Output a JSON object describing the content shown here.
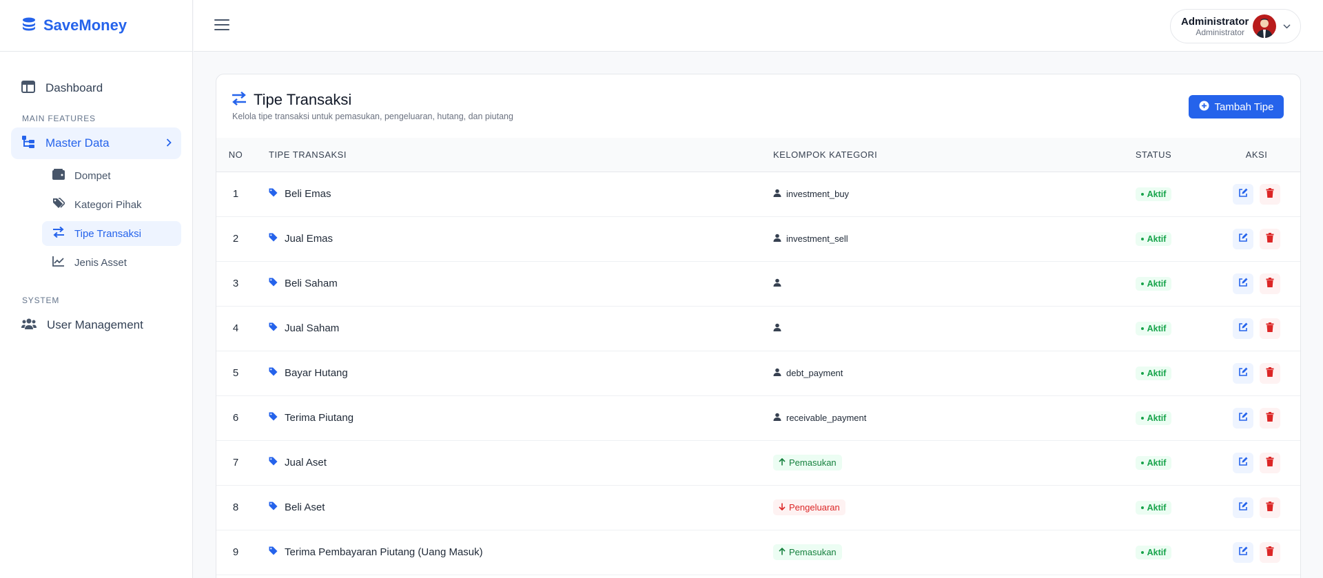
{
  "brand": {
    "name": "SaveMoney"
  },
  "sidebar": {
    "dashboard": "Dashboard",
    "section_main": "MAIN FEATURES",
    "master_data": "Master Data",
    "sub_items": [
      "Dompet",
      "Kategori Pihak",
      "Tipe Transaksi",
      "Jenis Asset"
    ],
    "section_system": "SYSTEM",
    "user_management": "User Management"
  },
  "user": {
    "name": "Administrator",
    "role": "Administrator"
  },
  "page": {
    "title": "Tipe Transaksi",
    "subtitle": "Kelola tipe transaksi untuk pemasukan, pengeluaran, hutang, dan piutang",
    "add_button": "Tambah Tipe"
  },
  "table": {
    "headers": [
      "NO",
      "TIPE TRANSAKSI",
      "KELOMPOK KATEGORI",
      "STATUS",
      "AKSI"
    ],
    "rows": [
      {
        "no": "1",
        "tipe": "Beli Emas",
        "kelompok": "investment_buy",
        "kind": "user",
        "status": "Aktif"
      },
      {
        "no": "2",
        "tipe": "Jual Emas",
        "kelompok": "investment_sell",
        "kind": "user",
        "status": "Aktif"
      },
      {
        "no": "3",
        "tipe": "Beli Saham",
        "kelompok": "",
        "kind": "user",
        "status": "Aktif"
      },
      {
        "no": "4",
        "tipe": "Jual Saham",
        "kelompok": "",
        "kind": "user",
        "status": "Aktif"
      },
      {
        "no": "5",
        "tipe": "Bayar Hutang",
        "kelompok": "debt_payment",
        "kind": "user",
        "status": "Aktif"
      },
      {
        "no": "6",
        "tipe": "Terima Piutang",
        "kelompok": "receivable_payment",
        "kind": "user",
        "status": "Aktif"
      },
      {
        "no": "7",
        "tipe": "Jual Aset",
        "kelompok": "Pemasukan",
        "kind": "in",
        "status": "Aktif"
      },
      {
        "no": "8",
        "tipe": "Beli Aset",
        "kelompok": "Pengeluaran",
        "kind": "out",
        "status": "Aktif"
      },
      {
        "no": "9",
        "tipe": "Terima Pembayaran Piutang (Uang Masuk)",
        "kelompok": "Pemasukan",
        "kind": "in",
        "status": "Aktif"
      }
    ]
  },
  "colors": {
    "accent": "#2563eb",
    "success": "#16a34a",
    "danger": "#dc2626"
  }
}
